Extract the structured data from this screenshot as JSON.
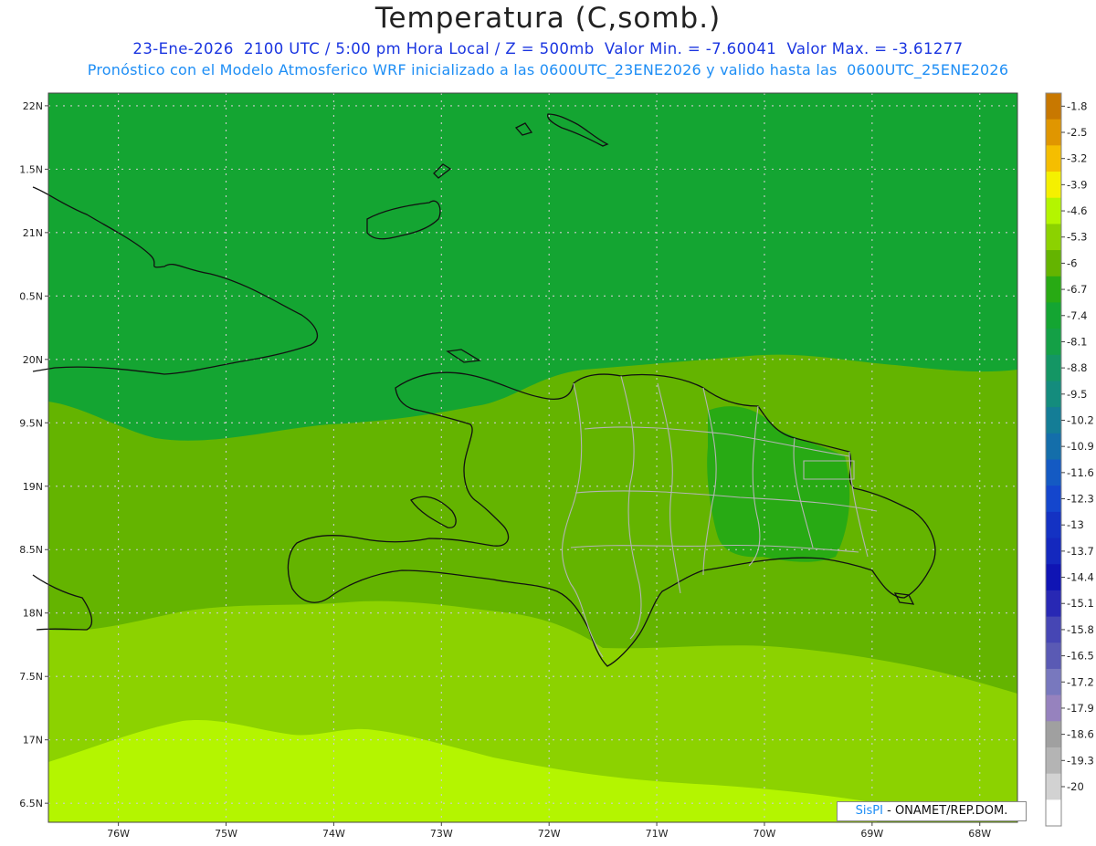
{
  "title": "Temperatura (C,somb.)",
  "subtitle_line1": "23-Ene-2026  2100 UTC / 5:00 pm Hora Local / Z = 500mb  Valor Min. = -7.60041  Valor Max. = -3.61277",
  "subtitle_line2": "Pronóstico con el Modelo Atmosferico WRF inicializado a las 0600UTC_23ENE2026 y valido hasta las  0600UTC_25ENE2026",
  "credit": {
    "brand": "SisPI",
    "text": " - ONAMET/REP.DOM."
  },
  "map": {
    "lon_range": [
      -76.65,
      -67.65
    ],
    "lat_range": [
      16.35,
      22.1
    ],
    "lon_ticks": [
      {
        "value": -76,
        "label": "76W"
      },
      {
        "value": -75,
        "label": "75W"
      },
      {
        "value": -74,
        "label": "74W"
      },
      {
        "value": -73,
        "label": "73W"
      },
      {
        "value": -72,
        "label": "72W"
      },
      {
        "value": -71,
        "label": "71W"
      },
      {
        "value": -70,
        "label": "70W"
      },
      {
        "value": -69,
        "label": "69W"
      },
      {
        "value": -68,
        "label": "68W"
      }
    ],
    "lat_ticks": [
      {
        "value": 22,
        "label": "22N"
      },
      {
        "value": 21.5,
        "label": "1.5N"
      },
      {
        "value": 21,
        "label": "21N"
      },
      {
        "value": 20.5,
        "label": "0.5N"
      },
      {
        "value": 20,
        "label": "20N"
      },
      {
        "value": 19.5,
        "label": "9.5N"
      },
      {
        "value": 19,
        "label": "19N"
      },
      {
        "value": 18.5,
        "label": "8.5N"
      },
      {
        "value": 18,
        "label": "18N"
      },
      {
        "value": 17.5,
        "label": "7.5N"
      },
      {
        "value": 17,
        "label": "17N"
      },
      {
        "value": 16.5,
        "label": "6.5N"
      }
    ],
    "grid": "dotted"
  },
  "colorbar": {
    "levels": [
      {
        "label": "-1.8",
        "color": "#c87800"
      },
      {
        "label": "-2.5",
        "color": "#e09600"
      },
      {
        "label": "-3.2",
        "color": "#f5be00"
      },
      {
        "label": "-3.9",
        "color": "#f5f000"
      },
      {
        "label": "-4.6",
        "color": "#b4f500"
      },
      {
        "label": "-5.3",
        "color": "#8cd200"
      },
      {
        "label": "-6",
        "color": "#64b400"
      },
      {
        "label": "-6.7",
        "color": "#28aa14"
      },
      {
        "label": "-7.4",
        "color": "#14a532"
      },
      {
        "label": "-8.1",
        "color": "#14a046"
      },
      {
        "label": "-8.8",
        "color": "#149664"
      },
      {
        "label": "-9.5",
        "color": "#148c7d"
      },
      {
        "label": "-10.2",
        "color": "#147d96"
      },
      {
        "label": "-10.9",
        "color": "#146eaa"
      },
      {
        "label": "-11.6",
        "color": "#145ac3"
      },
      {
        "label": "-12.3",
        "color": "#1446cd"
      },
      {
        "label": "-13",
        "color": "#1432c3"
      },
      {
        "label": "-13.7",
        "color": "#1428be"
      },
      {
        "label": "-14.4",
        "color": "#0f14b4"
      },
      {
        "label": "-15.1",
        "color": "#2828b4"
      },
      {
        "label": "-15.8",
        "color": "#4646b4"
      },
      {
        "label": "-16.5",
        "color": "#5a5ab4"
      },
      {
        "label": "-17.2",
        "color": "#7878be"
      },
      {
        "label": "-17.9",
        "color": "#9682be"
      },
      {
        "label": "-18.6",
        "color": "#a0a0a0"
      },
      {
        "label": "-19.3",
        "color": "#b4b4b4"
      },
      {
        "label": "-20",
        "color": "#d2d2d2"
      }
    ],
    "bottom_color": "#ffffff"
  },
  "field_colors": {
    "north": "#14a532",
    "central": "#64b400",
    "south": "#8cd200",
    "far_south": "#b4f500",
    "island_pockets": "#28aa14",
    "provinces": "#b4b4b4",
    "coastline": "#111111"
  }
}
